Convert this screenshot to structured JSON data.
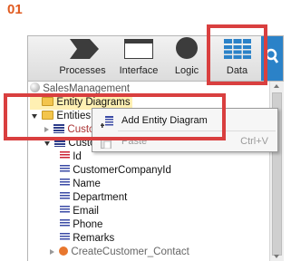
{
  "step_number": "01",
  "toolbar": {
    "buttons": [
      {
        "label": "Processes",
        "icon": "processes-icon"
      },
      {
        "label": "Interface",
        "icon": "interface-icon"
      },
      {
        "label": "Logic",
        "icon": "logic-icon"
      },
      {
        "label": "Data",
        "icon": "data-icon",
        "selected": true
      }
    ],
    "search_icon": "search-icon"
  },
  "tree": {
    "root": "SalesManagement",
    "entity_diagrams": "Entity Diagrams",
    "entities": "Entities",
    "customer_collapsed": "Customer",
    "customer_expanded": "Customer",
    "fields": [
      "Id",
      "CustomerCompanyId",
      "Name",
      "Department",
      "Email",
      "Phone",
      "Remarks"
    ],
    "next_item": "CreateCustomer_Contact"
  },
  "context_menu": {
    "items": [
      {
        "label": "Add Entity Diagram",
        "shortcut": "",
        "enabled": true
      },
      {
        "label": "Paste",
        "shortcut": "Ctrl+V",
        "enabled": false
      }
    ]
  },
  "colors": {
    "highlight": "#d93f3f",
    "step_number": "#e05a1f",
    "accent_blue": "#2b82c8"
  }
}
